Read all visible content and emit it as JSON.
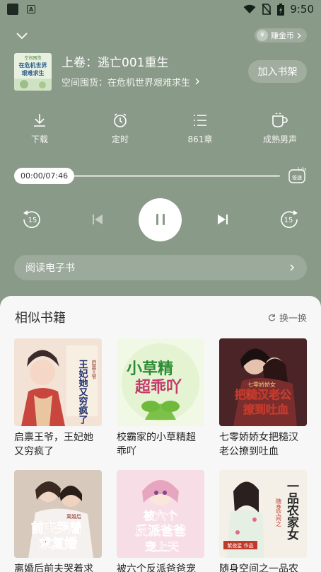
{
  "status_bar": {
    "time": "9:50"
  },
  "header": {
    "coin_label": "赚金币",
    "coin_symbol": "¥"
  },
  "current": {
    "chapter": "上卷：逃亡001重生",
    "book_title": "空间囤货：在危机世界艰难求生",
    "add_shelf": "加入书架",
    "cover_text_1": "在危机世界",
    "cover_text_2": "艰难求生",
    "cover_text_top": "空间囤货"
  },
  "tools": [
    {
      "label": "下载",
      "icon": "download-icon"
    },
    {
      "label": "定时",
      "icon": "alarm-clock-icon"
    },
    {
      "label": "861章",
      "icon": "chapter-list-icon"
    },
    {
      "label": "成熟男声",
      "icon": "voice-icon"
    }
  ],
  "player": {
    "time": "00:00/07:46",
    "progress": 0.0,
    "speed_top": "1.0x",
    "speed_label": "倍速",
    "rewind": "15",
    "forward": "15"
  },
  "read_ebook": "阅读电子书",
  "similar": {
    "title": "相似书籍",
    "refresh": "换一换",
    "books": [
      {
        "title": "启禀王爷，王妃她又穷疯了",
        "cover_text": "王妃她又穷疯了",
        "cover_side": "启禀王爷",
        "color": "#d9b3a0"
      },
      {
        "title": "校霸家的小草精超乖吖",
        "cover_text_1": "小草精",
        "cover_text_2": "超乖吖",
        "color": "#d8eec2"
      },
      {
        "title": "七零娇娇女把糙汉老公撩到吐血",
        "cover_text_1": "把糙汉老公",
        "cover_text_2": "撩到吐血",
        "cover_side": "七零娇娇女",
        "color": "#5b2b2e"
      },
      {
        "title": "离婚后前夫哭着求复婚",
        "cover_text_1": "前夫哭着",
        "cover_text_2": "求复婚",
        "cover_side": "离婚后",
        "color": "#d3c3b6"
      },
      {
        "title": "被六个反派爸爸宠上天",
        "cover_text_1": "被六个",
        "cover_text_2": "反派爸爸",
        "cover_text_3": "宠上天",
        "color": "#f1d6df"
      },
      {
        "title": "随身空间之一品农家女",
        "cover_text_1": "一品农家女",
        "cover_side": "随身空间之",
        "cover_author": "紫夜星 作品",
        "color": "#f3efe6"
      }
    ]
  }
}
